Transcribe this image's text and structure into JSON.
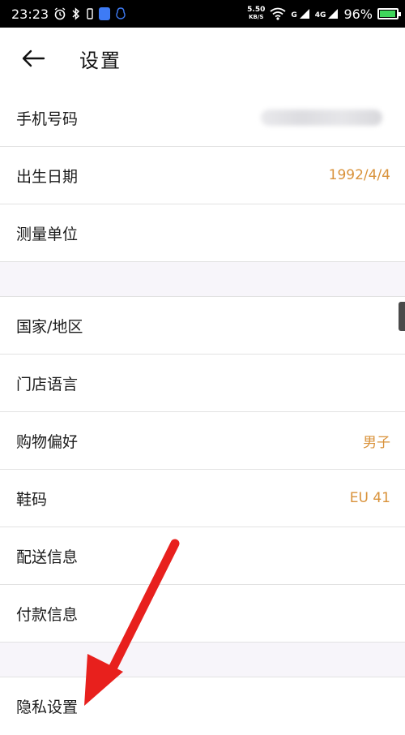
{
  "status_bar": {
    "time": "23:23",
    "net_speed_value": "5.50",
    "net_speed_unit": "KB/S",
    "signal_1_label": "G",
    "signal_2_label": "4G",
    "battery_percent": "96%",
    "battery_level": 0.96
  },
  "header": {
    "title": "设置"
  },
  "settings": {
    "group1": [
      {
        "label": "手机号码",
        "value": ""
      },
      {
        "label": "出生日期",
        "value": "1992/4/4"
      },
      {
        "label": "测量单位",
        "value": ""
      }
    ],
    "group2": [
      {
        "label": "国家/地区",
        "value": ""
      },
      {
        "label": "门店语言",
        "value": ""
      },
      {
        "label": "购物偏好",
        "value": "男子"
      },
      {
        "label": "鞋码",
        "value": "EU 41"
      },
      {
        "label": "配送信息",
        "value": ""
      },
      {
        "label": "付款信息",
        "value": ""
      }
    ],
    "group3": [
      {
        "label": "隐私设置",
        "value": ""
      }
    ]
  },
  "colors": {
    "accent_value": "#d9923a",
    "annotation_arrow": "#e8201d",
    "battery": "#3fd65b"
  }
}
